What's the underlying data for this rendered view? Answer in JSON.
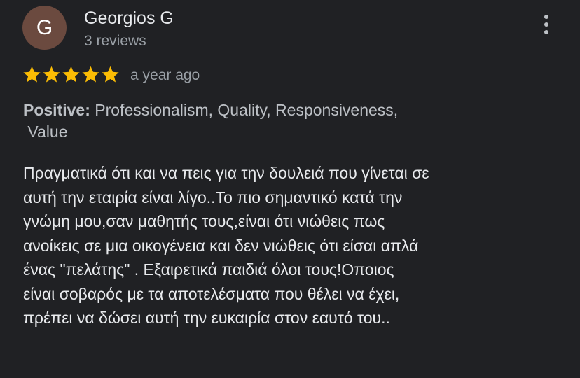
{
  "reviewer": {
    "initial": "G",
    "name": "Georgios G",
    "review_count": "3 reviews",
    "avatar_color": "#6b4a3f"
  },
  "rating": {
    "value": 5,
    "max": 5,
    "star_color": "#fbbc04",
    "time_ago": "a year ago"
  },
  "attributes": {
    "label": "Positive:",
    "line1": " Professionalism, Quality, Responsiveness,",
    "line2": "Value"
  },
  "review_lines": [
    "Πραγματικά ότι και να πεις για την δουλειά που γίνεται σε",
    "αυτή την εταιρία είναι λίγο..Το πιο σημαντικό κατά την",
    "γνώμη μου,σαν μαθητής τους,είναι ότι νιώθεις πως",
    "ανοίκεις σε μια οικογένεια και δεν νιώθεις ότι είσαι απλά",
    "ένας \"πελάτης\" . Εξαιρετικά παιδιά όλοι τους!Οποιος",
    "είναι σοβαρός με τα αποτελέσματα που θέλει να έχει,",
    "πρέπει να δώσει αυτή την ευκαιρία στον εαυτό του.."
  ],
  "menu_icon": "more-vert-icon"
}
